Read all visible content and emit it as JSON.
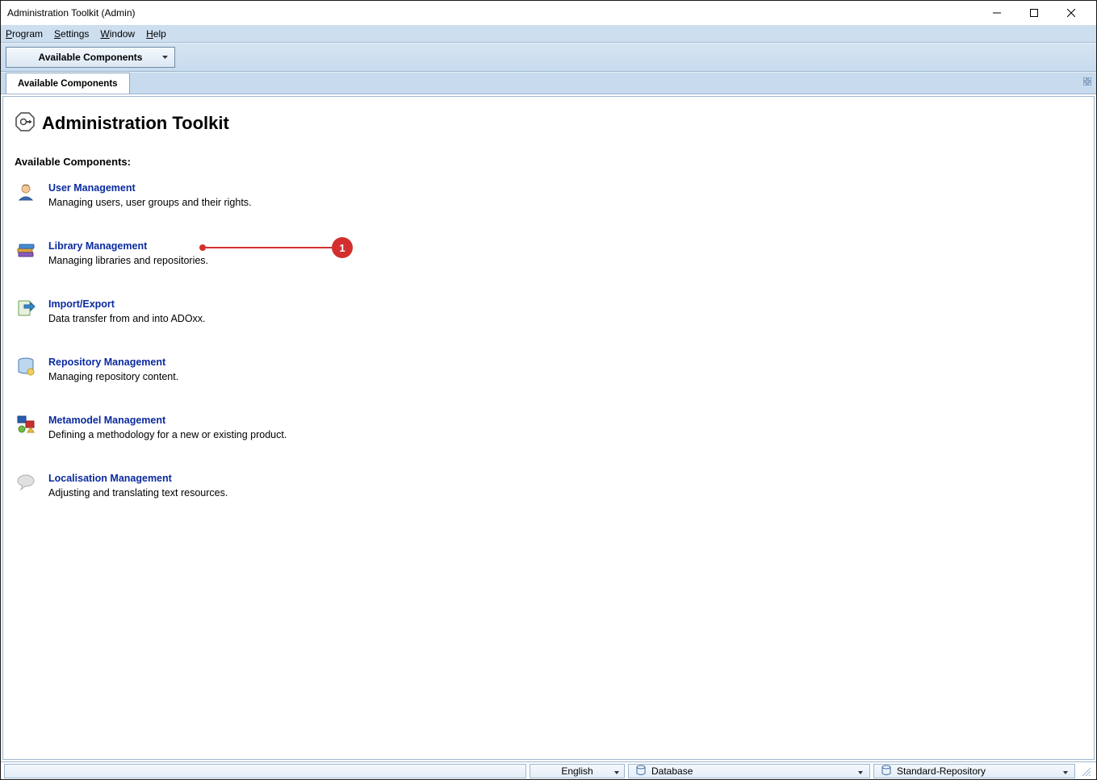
{
  "titlebar": "Administration Toolkit (Admin)",
  "menubar": [
    {
      "label_pre": "",
      "accel": "P",
      "label_post": "rogram"
    },
    {
      "label_pre": "",
      "accel": "S",
      "label_post": "ettings"
    },
    {
      "label_pre": "",
      "accel": "W",
      "label_post": "indow"
    },
    {
      "label_pre": "",
      "accel": "H",
      "label_post": "elp"
    }
  ],
  "toolbar": {
    "dropdown_label": "Available Components"
  },
  "tabs": [
    {
      "label": "Available Components",
      "active": true
    }
  ],
  "page": {
    "title": "Administration Toolkit",
    "section_label": "Available Components:",
    "components": [
      {
        "title": "User Management",
        "desc": "Managing users, user groups and their rights."
      },
      {
        "title": "Library Management",
        "desc": "Managing libraries and repositories."
      },
      {
        "title": "Import/Export",
        "desc": "Data transfer from and into ADOxx."
      },
      {
        "title": "Repository Management",
        "desc": "Managing repository content."
      },
      {
        "title": "Metamodel Management",
        "desc": "Defining a methodology for a new or existing product."
      },
      {
        "title": "Localisation Management",
        "desc": "Adjusting and translating text resources."
      }
    ]
  },
  "annotation": {
    "number": "1"
  },
  "statusbar": {
    "language": "English",
    "database_label": "Database",
    "repository_label": "Standard-Repository"
  }
}
